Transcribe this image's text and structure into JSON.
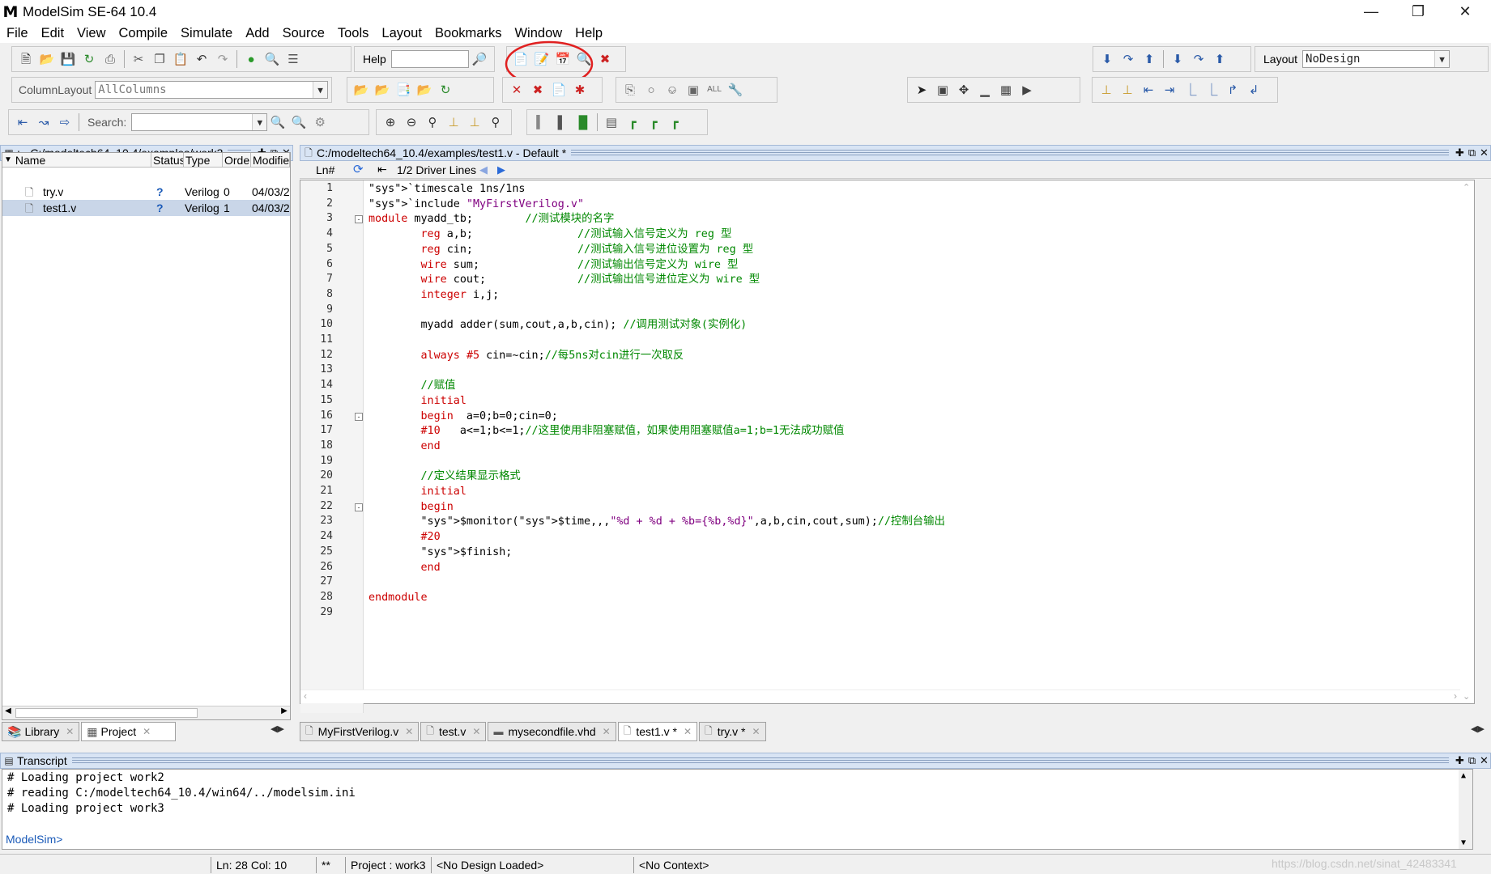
{
  "window": {
    "title": "ModelSim SE-64 10.4",
    "icon": "M"
  },
  "menu": [
    "File",
    "Edit",
    "View",
    "Compile",
    "Simulate",
    "Add",
    "Source",
    "Tools",
    "Layout",
    "Bookmarks",
    "Window",
    "Help"
  ],
  "toolbar": {
    "help_label": "Help",
    "layout_label": "Layout",
    "layout_value": "NoDesign",
    "columnlayout_label": "ColumnLayout",
    "columnlayout_value": "AllColumns",
    "search_label": "Search:",
    "highlight_color": "#e02020"
  },
  "project_panel": {
    "title": ": - C:/modeltech64_10.4/examples/work3",
    "columns": [
      "Name",
      "Status",
      "Type",
      "Order",
      "Modified"
    ],
    "files": [
      {
        "name": "try.v",
        "status": "?",
        "type": "Verilog",
        "order": "0",
        "modified": "04/03/2"
      },
      {
        "name": "test1.v",
        "status": "?",
        "type": "Verilog",
        "order": "1",
        "modified": "04/03/2"
      }
    ],
    "tabs": [
      "Library",
      "Project"
    ]
  },
  "editor": {
    "title": "C:/modeltech64_10.4/examples/test1.v - Default *",
    "ln_header": "Ln#",
    "driver_lines": "1/2 Driver Lines",
    "lines": [
      "`timescale 1ns/1ns",
      "`include \"MyFirstVerilog.v\"",
      "module myadd_tb;        //测试模块的名字",
      "        reg a,b;                //测试输入信号定义为 reg 型",
      "        reg cin;                //测试输入信号进位设置为 reg 型",
      "        wire sum;               //测试输出信号定义为 wire 型",
      "        wire cout;              //测试输出信号进位定义为 wire 型",
      "        integer i,j;",
      "",
      "        myadd adder(sum,cout,a,b,cin); //调用测试对象(实例化)",
      "",
      "        always #5 cin=~cin;//每5ns对cin进行一次取反",
      "",
      "        //赋值",
      "        initial",
      "        begin  a=0;b=0;cin=0;",
      "        #10   a<=1;b<=1;//这里使用非阻塞赋值，如果使用阻塞赋值a=1;b=1无法成功赋值",
      "        end",
      "",
      "        //定义结果显示格式",
      "        initial",
      "        begin",
      "        $monitor($time,,,\"%d + %d + %b={%b,%d}\",a,b,cin,cout,sum);//控制台输出",
      "        #20",
      "        $finish;",
      "        end",
      "",
      "endmodule",
      ""
    ],
    "tabs": [
      {
        "label": "MyFirstVerilog.v",
        "active": false
      },
      {
        "label": "test.v",
        "active": false
      },
      {
        "label": "mysecondfile.vhd",
        "active": false
      },
      {
        "label": "test1.v *",
        "active": true
      },
      {
        "label": "try.v *",
        "active": false
      }
    ]
  },
  "transcript": {
    "title": "Transcript",
    "lines": [
      "# Loading project work2",
      "# reading C:/modeltech64_10.4/win64/../modelsim.ini",
      "# Loading project work3"
    ],
    "prompt": "ModelSim>"
  },
  "statusbar": {
    "position": "Ln:  28 Col: 10",
    "flags": "**",
    "project": "Project : work3",
    "design": "<No Design Loaded>",
    "context": "<No Context>",
    "watermark": "https://blog.csdn.net/sinat_42483341"
  }
}
